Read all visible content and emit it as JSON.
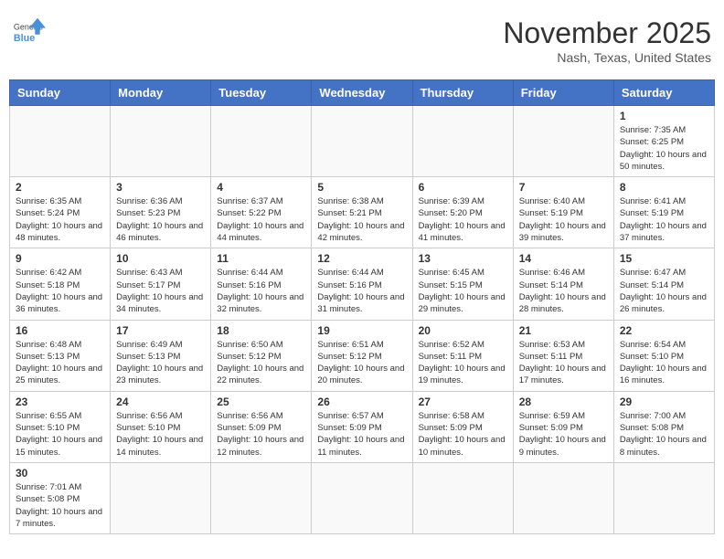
{
  "header": {
    "logo_general": "General",
    "logo_blue": "Blue",
    "month_title": "November 2025",
    "location": "Nash, Texas, United States"
  },
  "weekdays": [
    "Sunday",
    "Monday",
    "Tuesday",
    "Wednesday",
    "Thursday",
    "Friday",
    "Saturday"
  ],
  "weeks": [
    [
      {
        "day": "",
        "info": ""
      },
      {
        "day": "",
        "info": ""
      },
      {
        "day": "",
        "info": ""
      },
      {
        "day": "",
        "info": ""
      },
      {
        "day": "",
        "info": ""
      },
      {
        "day": "",
        "info": ""
      },
      {
        "day": "1",
        "info": "Sunrise: 7:35 AM\nSunset: 6:25 PM\nDaylight: 10 hours and 50 minutes."
      }
    ],
    [
      {
        "day": "2",
        "info": "Sunrise: 6:35 AM\nSunset: 5:24 PM\nDaylight: 10 hours and 48 minutes."
      },
      {
        "day": "3",
        "info": "Sunrise: 6:36 AM\nSunset: 5:23 PM\nDaylight: 10 hours and 46 minutes."
      },
      {
        "day": "4",
        "info": "Sunrise: 6:37 AM\nSunset: 5:22 PM\nDaylight: 10 hours and 44 minutes."
      },
      {
        "day": "5",
        "info": "Sunrise: 6:38 AM\nSunset: 5:21 PM\nDaylight: 10 hours and 42 minutes."
      },
      {
        "day": "6",
        "info": "Sunrise: 6:39 AM\nSunset: 5:20 PM\nDaylight: 10 hours and 41 minutes."
      },
      {
        "day": "7",
        "info": "Sunrise: 6:40 AM\nSunset: 5:19 PM\nDaylight: 10 hours and 39 minutes."
      },
      {
        "day": "8",
        "info": "Sunrise: 6:41 AM\nSunset: 5:19 PM\nDaylight: 10 hours and 37 minutes."
      }
    ],
    [
      {
        "day": "9",
        "info": "Sunrise: 6:42 AM\nSunset: 5:18 PM\nDaylight: 10 hours and 36 minutes."
      },
      {
        "day": "10",
        "info": "Sunrise: 6:43 AM\nSunset: 5:17 PM\nDaylight: 10 hours and 34 minutes."
      },
      {
        "day": "11",
        "info": "Sunrise: 6:44 AM\nSunset: 5:16 PM\nDaylight: 10 hours and 32 minutes."
      },
      {
        "day": "12",
        "info": "Sunrise: 6:44 AM\nSunset: 5:16 PM\nDaylight: 10 hours and 31 minutes."
      },
      {
        "day": "13",
        "info": "Sunrise: 6:45 AM\nSunset: 5:15 PM\nDaylight: 10 hours and 29 minutes."
      },
      {
        "day": "14",
        "info": "Sunrise: 6:46 AM\nSunset: 5:14 PM\nDaylight: 10 hours and 28 minutes."
      },
      {
        "day": "15",
        "info": "Sunrise: 6:47 AM\nSunset: 5:14 PM\nDaylight: 10 hours and 26 minutes."
      }
    ],
    [
      {
        "day": "16",
        "info": "Sunrise: 6:48 AM\nSunset: 5:13 PM\nDaylight: 10 hours and 25 minutes."
      },
      {
        "day": "17",
        "info": "Sunrise: 6:49 AM\nSunset: 5:13 PM\nDaylight: 10 hours and 23 minutes."
      },
      {
        "day": "18",
        "info": "Sunrise: 6:50 AM\nSunset: 5:12 PM\nDaylight: 10 hours and 22 minutes."
      },
      {
        "day": "19",
        "info": "Sunrise: 6:51 AM\nSunset: 5:12 PM\nDaylight: 10 hours and 20 minutes."
      },
      {
        "day": "20",
        "info": "Sunrise: 6:52 AM\nSunset: 5:11 PM\nDaylight: 10 hours and 19 minutes."
      },
      {
        "day": "21",
        "info": "Sunrise: 6:53 AM\nSunset: 5:11 PM\nDaylight: 10 hours and 17 minutes."
      },
      {
        "day": "22",
        "info": "Sunrise: 6:54 AM\nSunset: 5:10 PM\nDaylight: 10 hours and 16 minutes."
      }
    ],
    [
      {
        "day": "23",
        "info": "Sunrise: 6:55 AM\nSunset: 5:10 PM\nDaylight: 10 hours and 15 minutes."
      },
      {
        "day": "24",
        "info": "Sunrise: 6:56 AM\nSunset: 5:10 PM\nDaylight: 10 hours and 14 minutes."
      },
      {
        "day": "25",
        "info": "Sunrise: 6:56 AM\nSunset: 5:09 PM\nDaylight: 10 hours and 12 minutes."
      },
      {
        "day": "26",
        "info": "Sunrise: 6:57 AM\nSunset: 5:09 PM\nDaylight: 10 hours and 11 minutes."
      },
      {
        "day": "27",
        "info": "Sunrise: 6:58 AM\nSunset: 5:09 PM\nDaylight: 10 hours and 10 minutes."
      },
      {
        "day": "28",
        "info": "Sunrise: 6:59 AM\nSunset: 5:09 PM\nDaylight: 10 hours and 9 minutes."
      },
      {
        "day": "29",
        "info": "Sunrise: 7:00 AM\nSunset: 5:08 PM\nDaylight: 10 hours and 8 minutes."
      }
    ],
    [
      {
        "day": "30",
        "info": "Sunrise: 7:01 AM\nSunset: 5:08 PM\nDaylight: 10 hours and 7 minutes."
      },
      {
        "day": "",
        "info": ""
      },
      {
        "day": "",
        "info": ""
      },
      {
        "day": "",
        "info": ""
      },
      {
        "day": "",
        "info": ""
      },
      {
        "day": "",
        "info": ""
      },
      {
        "day": "",
        "info": ""
      }
    ]
  ]
}
